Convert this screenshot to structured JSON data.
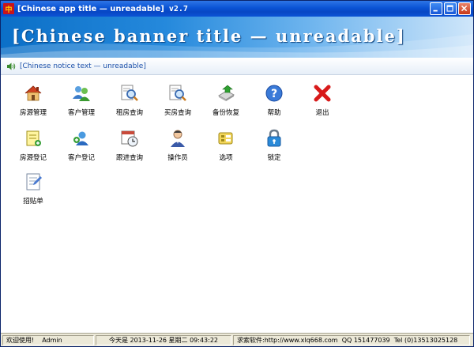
{
  "window": {
    "title": "[Chinese app title — unreadable]",
    "version": "v2.7"
  },
  "banner": {
    "title": "[Chinese banner title — unreadable]"
  },
  "notice": {
    "text": "[Chinese notice text — unreadable]"
  },
  "menu": {
    "rows": [
      [
        {
          "label": "房源管理",
          "icon": "house-icon"
        },
        {
          "label": "客户管理",
          "icon": "users-icon"
        },
        {
          "label": "租房查询",
          "icon": "search-doc-icon"
        },
        {
          "label": "买房查询",
          "icon": "search-doc-icon"
        },
        {
          "label": "备份恢复",
          "icon": "backup-icon"
        },
        {
          "label": "帮助",
          "icon": "help-icon"
        },
        {
          "label": "退出",
          "icon": "exit-icon"
        }
      ],
      [
        {
          "label": "房源登记",
          "icon": "register-house-icon"
        },
        {
          "label": "客户登记",
          "icon": "add-user-icon"
        },
        {
          "label": "跟进查询",
          "icon": "calendar-clock-icon"
        },
        {
          "label": "操作员",
          "icon": "operator-icon"
        },
        {
          "label": "选项",
          "icon": "options-icon"
        },
        {
          "label": "锁定",
          "icon": "lock-icon"
        }
      ],
      [
        {
          "label": "招贴单",
          "icon": "poster-icon"
        }
      ]
    ]
  },
  "status": {
    "welcome": "欢迎使用!",
    "user": "Admin",
    "date_label": "今天是",
    "date": "2013-11-26",
    "weekday": "星期二",
    "time": "09:43:22",
    "software_label": "求索软件:",
    "website": "http://www.xlq668.com",
    "qq_label": "QQ",
    "qq": "151477039",
    "tel_label": "Tel",
    "tel": "(0)13513025128"
  },
  "colors": {
    "titlebar": "#0a53d4",
    "banner_start": "#0b6fc7",
    "notice_text": "#1a4fa8"
  }
}
